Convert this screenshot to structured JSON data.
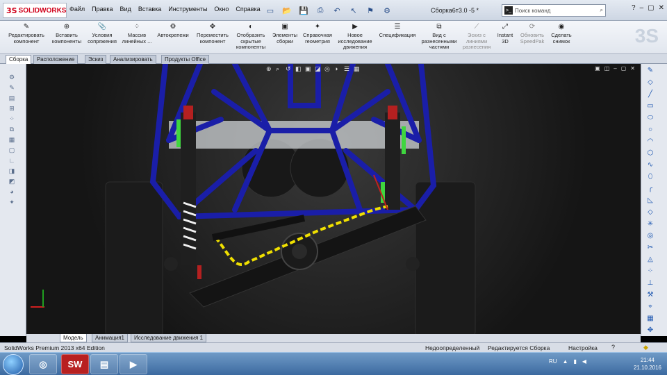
{
  "app": {
    "logo_text": "SOLIDWORKS",
    "document_title": "Сборка6т3.0 -5 *",
    "search_placeholder": "Поиск команд"
  },
  "menu": [
    "Файл",
    "Правка",
    "Вид",
    "Вставка",
    "Инструменты",
    "Окно",
    "Справка"
  ],
  "ribbon": [
    {
      "label": "Редактировать компонент",
      "enabled": true
    },
    {
      "label": "Вставить компоненты",
      "enabled": true
    },
    {
      "label": "Условия сопряжения",
      "enabled": true
    },
    {
      "label": "Массив линейных ...",
      "enabled": true
    },
    {
      "label": "Автокрепежи",
      "enabled": true
    },
    {
      "label": "Переместить компонент",
      "enabled": true
    },
    {
      "label": "Отобразить скрытые компоненты",
      "enabled": true
    },
    {
      "label": "Элементы сборки",
      "enabled": true
    },
    {
      "label": "Справочная геометрия",
      "enabled": true
    },
    {
      "label": "Новое исследование движения",
      "enabled": true
    },
    {
      "label": "Спецификация",
      "enabled": true
    },
    {
      "label": "Вид с разнесенными частями",
      "enabled": true
    },
    {
      "label": "Эскиз с линиями разнесения",
      "enabled": false
    },
    {
      "label": "Instant 3D",
      "enabled": true
    },
    {
      "label": "Обновить SpeedPak",
      "enabled": false
    },
    {
      "label": "Сделать снимок",
      "enabled": true
    }
  ],
  "tabs": [
    "Сборка",
    "Расположение",
    "Эскиз",
    "Анализировать",
    "Продукты Office"
  ],
  "bottom_tabs": [
    "Модель",
    "Анимация1",
    "Исследование движения 1"
  ],
  "status": {
    "left": "SolidWorks Premium 2013 x64 Edition",
    "mid1": "Недоопределенный",
    "mid2": "Редактируется Сборка",
    "right": "Настройка"
  },
  "taskbar": {
    "language": "RU",
    "time": "21:44",
    "date": "21.10.2016"
  },
  "colors": {
    "frame": "#1a1ea8",
    "suspension_arm": "#141414",
    "hose": "#f0e000",
    "spring": "#f0f0f0"
  }
}
